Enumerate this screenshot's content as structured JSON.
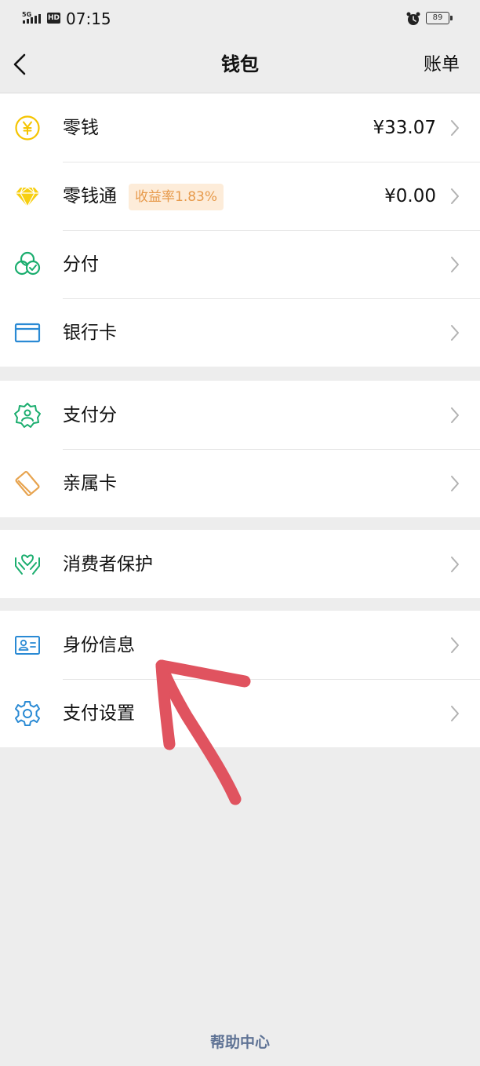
{
  "status_bar": {
    "network": "5G",
    "hd": "HD",
    "time": "07:15",
    "battery": "89"
  },
  "nav": {
    "title": "钱包",
    "right": "账单"
  },
  "groups": [
    {
      "items": [
        {
          "label": "零钱",
          "value": "¥33.07",
          "icon": "coin-icon",
          "color": "#f5c400"
        },
        {
          "label": "零钱通",
          "badge": "收益率1.83%",
          "value": "¥0.00",
          "icon": "diamond-icon",
          "color": "#f5c400"
        },
        {
          "label": "分付",
          "icon": "circles-icon",
          "color": "#1aad6e"
        },
        {
          "label": "银行卡",
          "icon": "card-icon",
          "color": "#2a8ad4"
        }
      ]
    },
    {
      "items": [
        {
          "label": "支付分",
          "icon": "score-badge-icon",
          "color": "#1aad6e"
        },
        {
          "label": "亲属卡",
          "icon": "family-card-icon",
          "color": "#e7a34e"
        }
      ]
    },
    {
      "items": [
        {
          "label": "消费者保护",
          "icon": "hands-icon",
          "color": "#1aad6e"
        }
      ]
    },
    {
      "items": [
        {
          "label": "身份信息",
          "icon": "id-card-icon",
          "color": "#2a8ad4"
        },
        {
          "label": "支付设置",
          "icon": "gear-icon",
          "color": "#2a8ad4"
        }
      ]
    }
  ],
  "help": "帮助中心",
  "annotation": {
    "color": "#e0535f",
    "icon": "red-arrow-icon"
  }
}
